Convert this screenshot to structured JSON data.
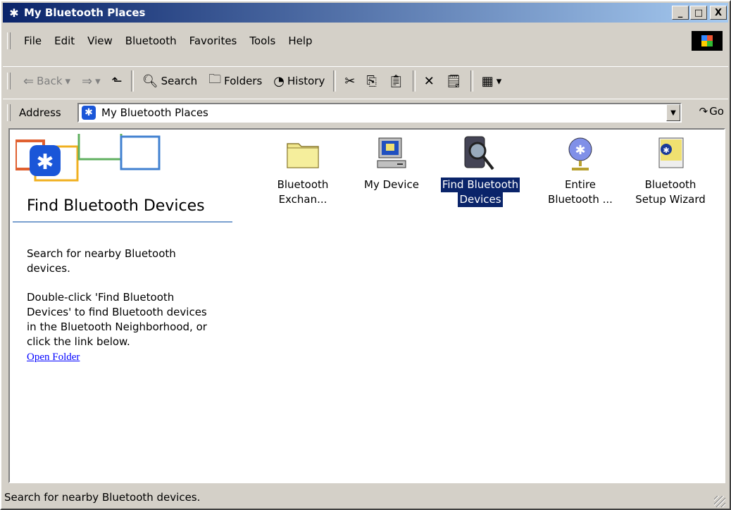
{
  "window": {
    "title": "My Bluetooth Places",
    "minimize": "_",
    "maximize": "□",
    "close": "X"
  },
  "menu": [
    {
      "label": "File"
    },
    {
      "label": "Edit"
    },
    {
      "label": "View"
    },
    {
      "label": "Bluetooth"
    },
    {
      "label": "Favorites"
    },
    {
      "label": "Tools"
    },
    {
      "label": "Help"
    }
  ],
  "toolbar": {
    "back": "Back",
    "search": "Search",
    "folders": "Folders",
    "history": "History"
  },
  "address": {
    "label": "Address",
    "value": "My Bluetooth Places",
    "go": "Go"
  },
  "webview": {
    "title": "Find Bluetooth Devices",
    "desc1": "Search for nearby Bluetooth devices.",
    "desc2": "Double-click 'Find Bluetooth Devices' to find Bluetooth devices in the Bluetooth Neighborhood, or click the link below.",
    "link": "Open Folder"
  },
  "items": [
    {
      "line1": "Bluetooth",
      "line2": "Exchan...",
      "icon": "folder-icon"
    },
    {
      "line1": "My Device",
      "line2": "",
      "icon": "computer-icon"
    },
    {
      "line1": "Find Bluetooth",
      "line2": "Devices",
      "icon": "magnifier-device-icon",
      "selected": true
    },
    {
      "line1": "Entire",
      "line2": "Bluetooth ...",
      "icon": "bluetooth-globe-icon"
    },
    {
      "line1": "Bluetooth",
      "line2": "Setup Wizard",
      "icon": "setup-wizard-icon"
    }
  ],
  "status": "Search for nearby Bluetooth devices.",
  "colors": {
    "titlebar_start": "#0a246a",
    "titlebar_end": "#a6caf0",
    "selection": "#0a246a",
    "link": "#0000ff"
  }
}
